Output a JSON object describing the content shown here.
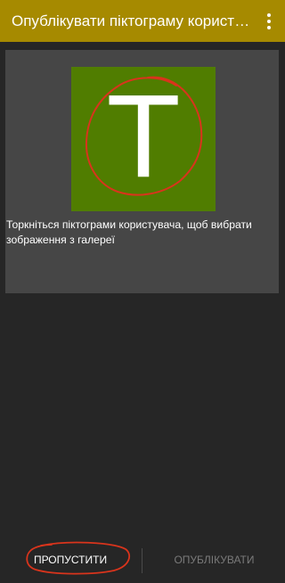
{
  "app_bar": {
    "title": "Опублікувати піктограму користувача",
    "menu_icon": "more-vert-icon",
    "background_color": "#a68a00"
  },
  "profile_card": {
    "avatar_letter": "T",
    "avatar_color": "#507d00",
    "hint": "Торкніться піктограми користувача, щоб вибрати зображення з галереї"
  },
  "actions": {
    "skip_label": "ПРОПУСТИТИ",
    "publish_label": "ОПУБЛІКУВАТИ",
    "publish_enabled": false
  },
  "annotation_color": "#d9341c"
}
